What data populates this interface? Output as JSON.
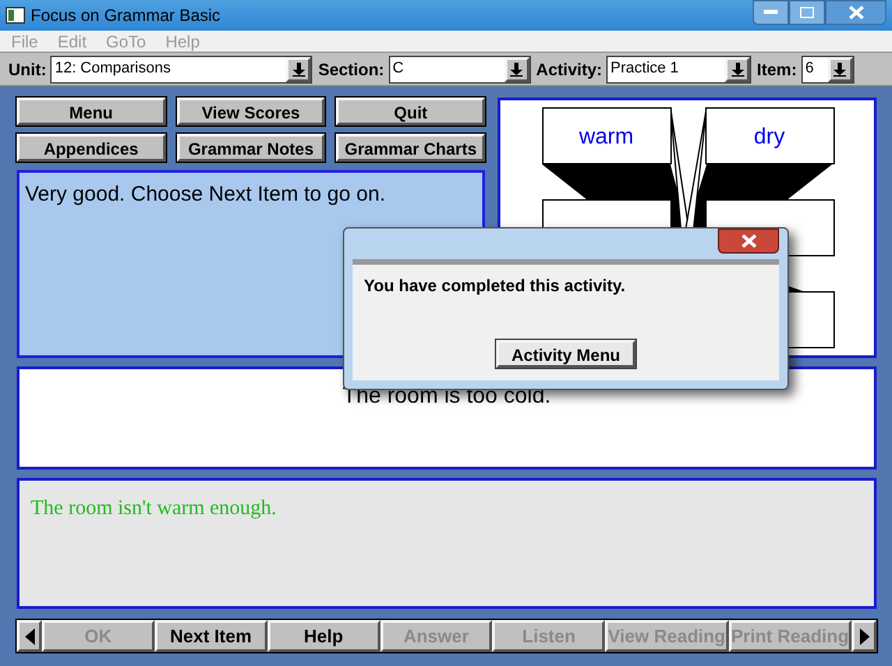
{
  "window": {
    "title": "Focus on Grammar Basic"
  },
  "menu": [
    {
      "label": "File",
      "disabled": true
    },
    {
      "label": "Edit",
      "disabled": true
    },
    {
      "label": "GoTo",
      "disabled": true
    },
    {
      "label": "Help",
      "disabled": true
    }
  ],
  "selectors": [
    {
      "label": "Unit:",
      "value": "12:  Comparisons"
    },
    {
      "label": "Section:",
      "value": "C"
    },
    {
      "label": "Activity:",
      "value": "Practice 1"
    },
    {
      "label": "Item:",
      "value": "6"
    }
  ],
  "nav_buttons": [
    {
      "label": "Menu"
    },
    {
      "label": "View Scores"
    },
    {
      "label": "Quit"
    },
    {
      "label": "Appendices"
    },
    {
      "label": "Grammar Notes"
    },
    {
      "label": "Grammar Charts"
    }
  ],
  "feedback": "Very good. Choose Next Item to go on.",
  "word_cards": [
    "warm",
    "dry"
  ],
  "sentence": "The room is too cold.",
  "answer": "The room isn't warm enough.",
  "bottom_buttons": [
    {
      "label": "OK",
      "disabled": true
    },
    {
      "label": "Next Item",
      "disabled": false
    },
    {
      "label": "Help",
      "disabled": false
    },
    {
      "label": "Answer",
      "disabled": true
    },
    {
      "label": "Listen",
      "disabled": true
    },
    {
      "label": "View Reading",
      "disabled": true
    },
    {
      "label": "Print Reading",
      "disabled": true
    }
  ],
  "dialog": {
    "message": "You have completed this activity.",
    "button": "Activity Menu"
  }
}
